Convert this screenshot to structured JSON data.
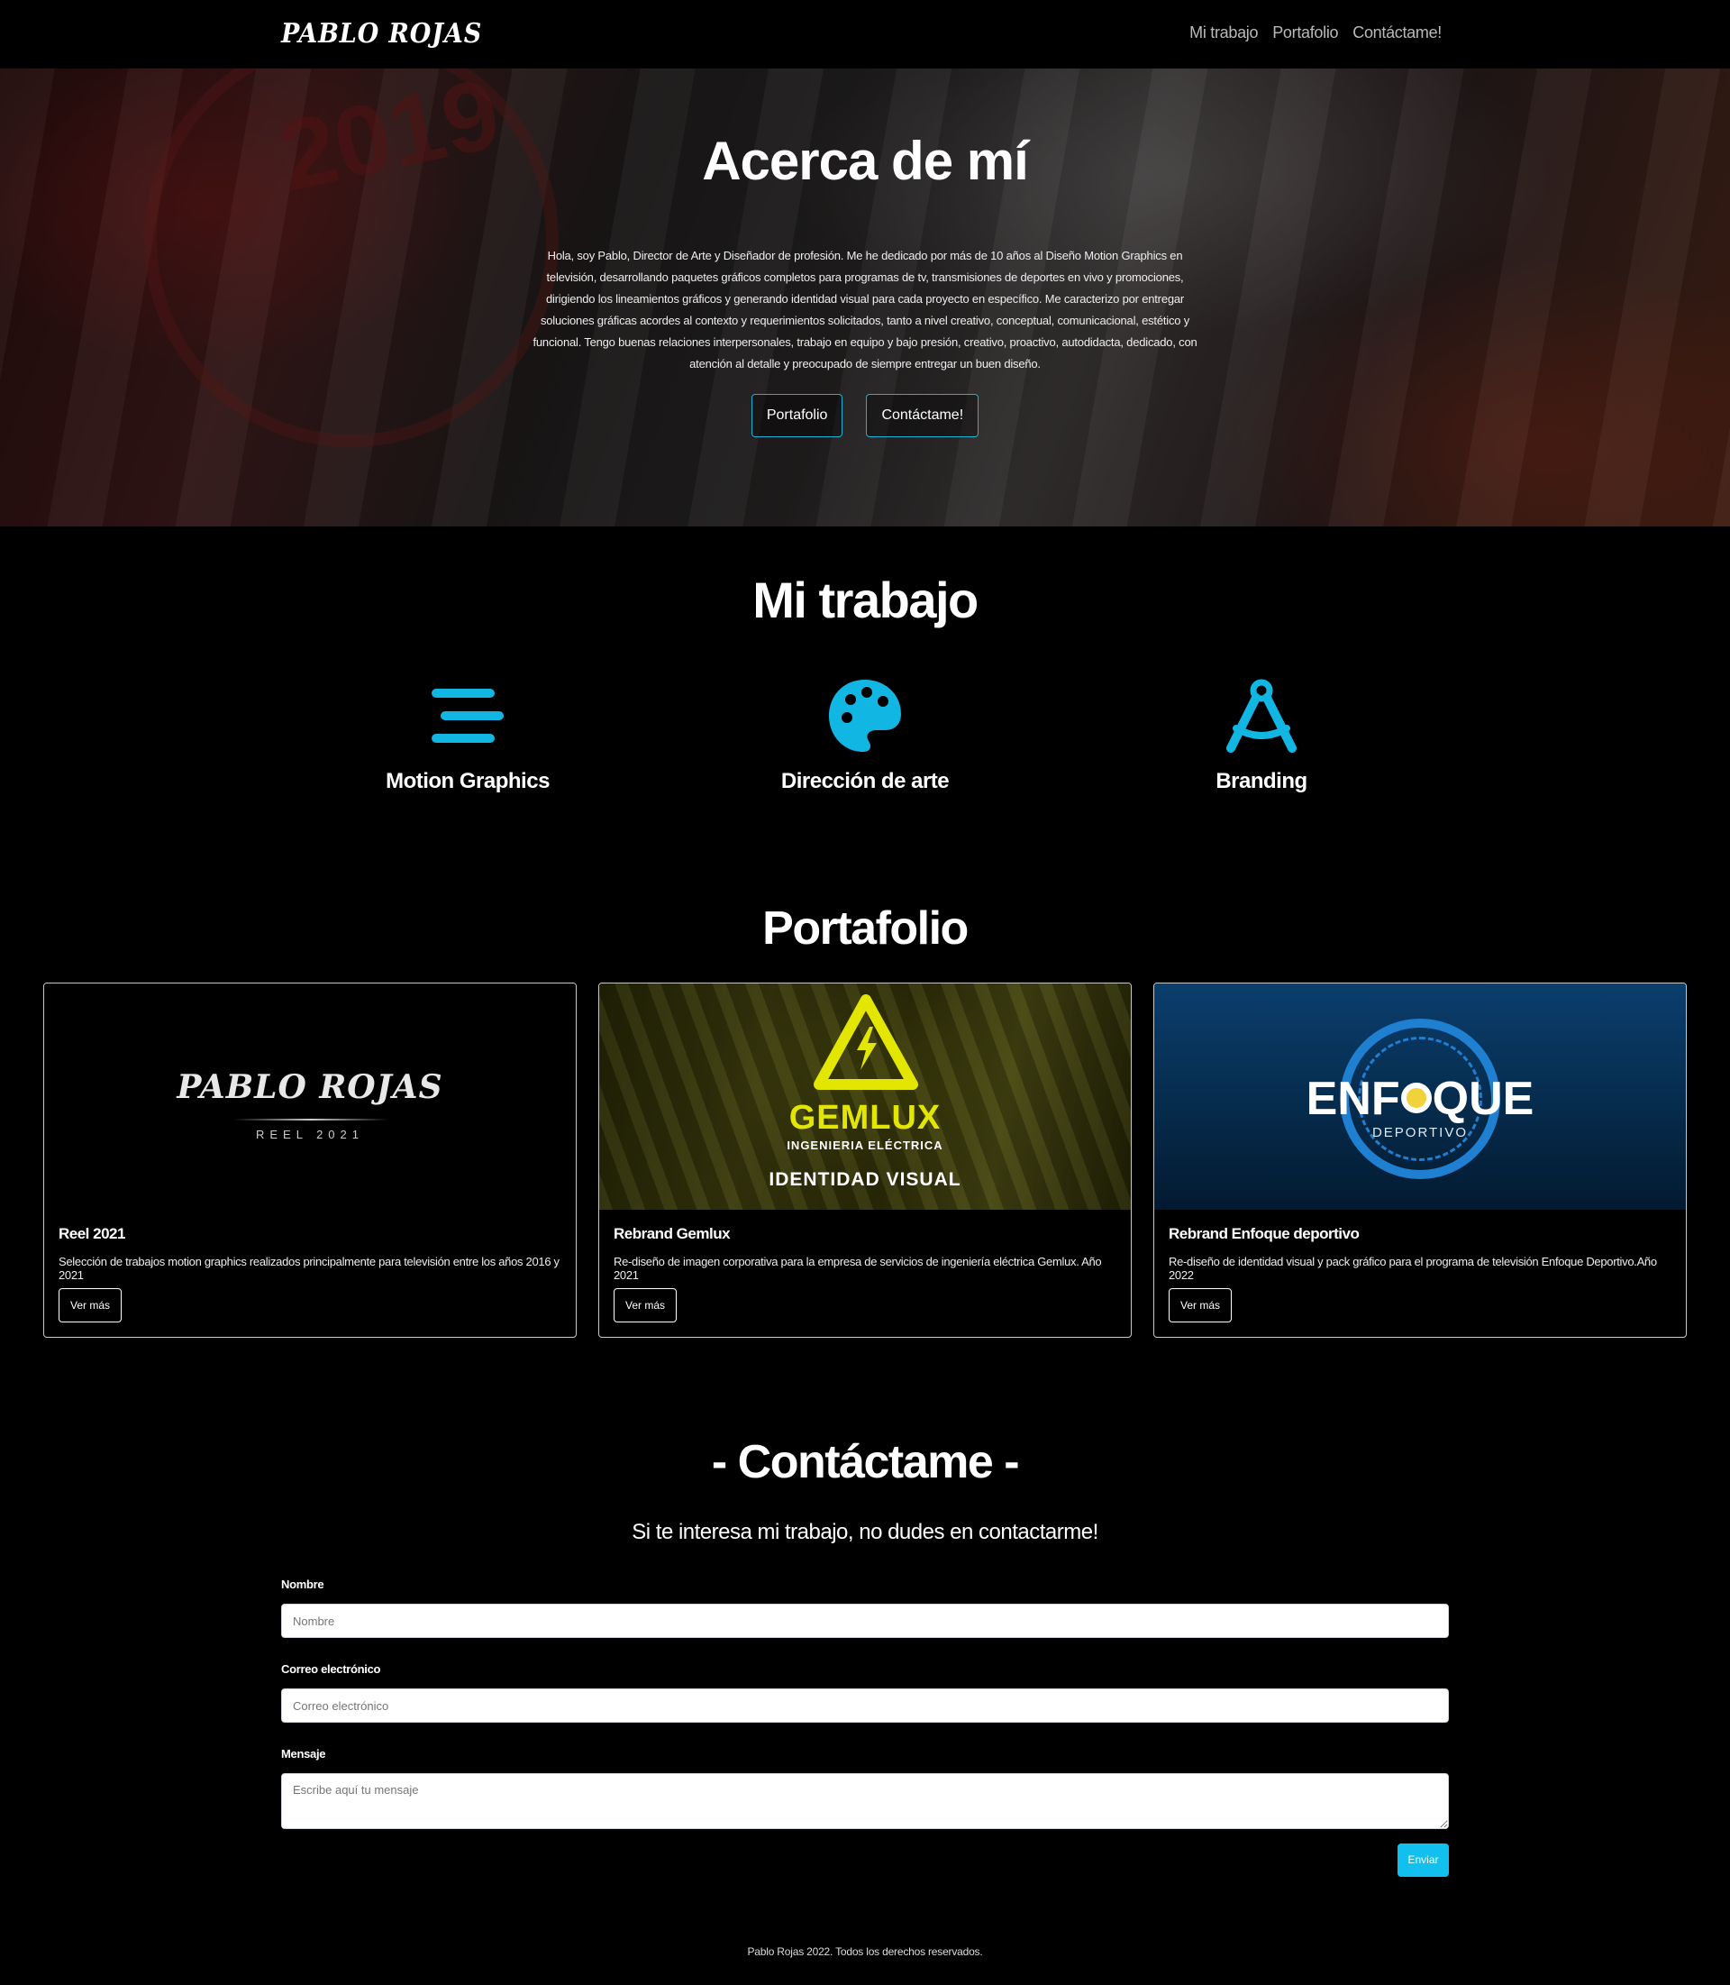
{
  "navbar": {
    "brand": "PABLO ROJAS",
    "links": [
      "Mi trabajo",
      "Portafolio",
      "Contáctame!"
    ]
  },
  "hero": {
    "background_year": "2019",
    "title": "Acerca de mí",
    "text": "Hola, soy Pablo, Director de Arte y Diseñador de profesión. Me he dedicado por más de 10 años al Diseño Motion Graphics en televisión, desarrollando paquetes gráficos completos para programas de tv, transmisiones de deportes en vivo y promociones, dirigiendo los lineamientos gráficos y generando identidad visual para cada proyecto en específico. Me caracterizo por entregar soluciones gráficas acordes al contexto y requerimientos solicitados, tanto a nivel creativo, conceptual, comunicacional, estético y funcional. Tengo buenas relaciones interpersonales, trabajo en equipo y bajo presión, creativo, proactivo, autodidacta, dedicado, con atención al detalle y preocupado de siempre entregar un buen diseño.",
    "buttons": [
      "Portafolio",
      "Contáctame!"
    ]
  },
  "work": {
    "title": "Mi trabajo",
    "items": [
      {
        "label": "Motion Graphics",
        "icon": "bars-staggered-icon"
      },
      {
        "label": "Dirección de arte",
        "icon": "palette-icon"
      },
      {
        "label": "Branding",
        "icon": "compass-drafting-icon"
      }
    ],
    "accent_color": "#12b6e2"
  },
  "portfolio": {
    "title": "Portafolio",
    "cards": [
      {
        "title": "Reel 2021",
        "text": "Selección de trabajos motion graphics realizados principalmente para televisión entre los años 2016 y 2021",
        "button": "Ver más",
        "image": {
          "logo": "PABLO ROJAS",
          "sub": "REEL 2021"
        }
      },
      {
        "title": "Rebrand Gemlux",
        "text": "Re-diseño de imagen corporativa para la empresa de servicios de ingeniería eléctrica Gemlux. Año 2021",
        "button": "Ver más",
        "image": {
          "logo": "GEMLUX",
          "sub": "INGENIERIA ELÉCTRICA",
          "caption": "IDENTIDAD VISUAL"
        }
      },
      {
        "title": "Rebrand Enfoque deportivo",
        "text": "Re-diseño de identidad visual y pack gráfico para el programa de televisión Enfoque Deportivo.Año 2022",
        "button": "Ver más",
        "image": {
          "logo_start": "ENF",
          "logo_end": "QUE",
          "sub": "DEPORTIVO"
        }
      }
    ]
  },
  "contact": {
    "title": "- Contáctame -",
    "subtitle": "Si te interesa mi trabajo, no dudes en contactarme!",
    "fields": [
      {
        "label": "Nombre",
        "placeholder": "Nombre"
      },
      {
        "label": "Correo electrónico",
        "placeholder": "Correo electrónico"
      },
      {
        "label": "Mensaje",
        "placeholder": "Escribe aquí tu mensaje"
      }
    ],
    "submit": "Enviar",
    "submit_color": "#11c0ee"
  },
  "footer": {
    "text": "Pablo Rojas 2022. Todos los derechos reservados."
  }
}
